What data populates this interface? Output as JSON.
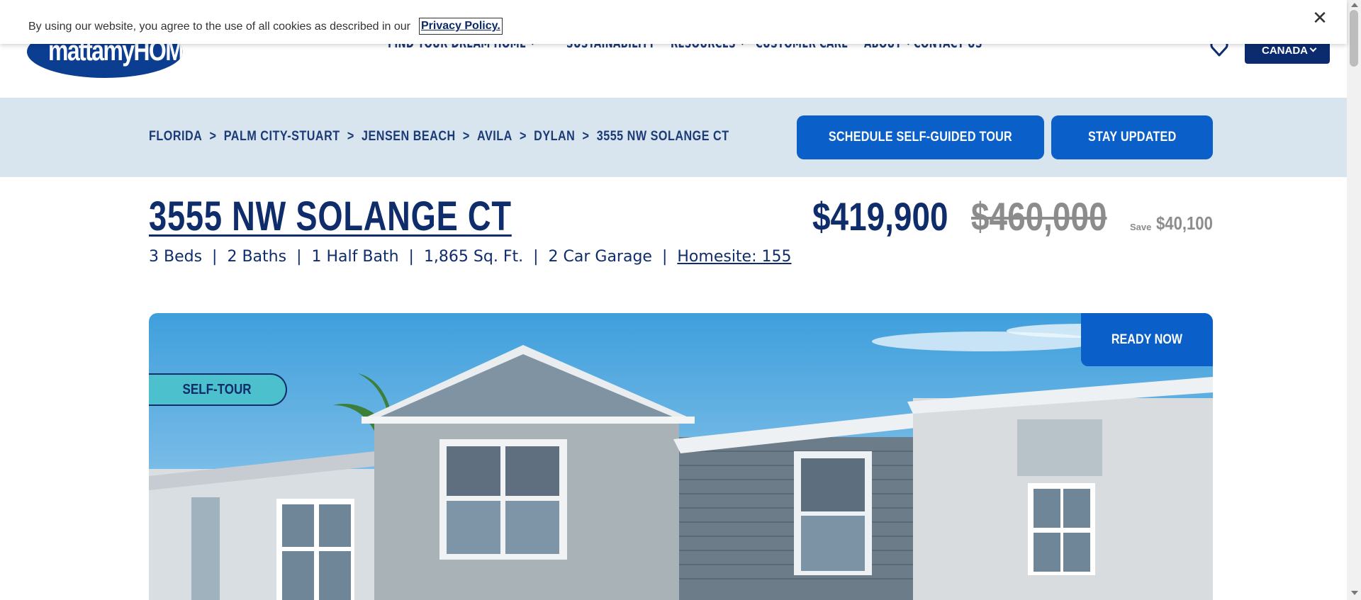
{
  "cookie": {
    "text": "By using our website, you agree to the use of all cookies as described in our",
    "link": "Privacy Policy.",
    "close": "✕"
  },
  "header": {
    "logo": "mattamyHOMES",
    "nav": [
      {
        "label": "FIND YOUR DREAM HOME",
        "has_dropdown": true
      },
      {
        "label": "SUSTAINABILITY",
        "has_dropdown": false
      },
      {
        "label": "RESOURCES",
        "has_dropdown": true
      },
      {
        "label": "CUSTOMER CARE",
        "has_dropdown": false
      },
      {
        "label": "ABOUT",
        "has_dropdown": true
      },
      {
        "label": "CONTACT US",
        "has_dropdown": false
      }
    ],
    "country": "CANADA"
  },
  "breadcrumb": [
    "FLORIDA",
    "PALM CITY-STUART",
    "JENSEN BEACH",
    "AVILA",
    "DYLAN",
    "3555 NW SOLANGE CT"
  ],
  "breadcrumb_sep": ">",
  "actions": {
    "tour": "SCHEDULE SELF-GUIDED TOUR",
    "updated": "STAY UPDATED"
  },
  "listing": {
    "title": "3555 NW SOLANGE CT",
    "price": "$419,900",
    "old_price": "$460,000",
    "save_label": "Save",
    "save_amount": "$40,100",
    "specs": {
      "beds": "3 Beds",
      "baths": "2 Baths",
      "half_bath": "1 Half Bath",
      "sqft": "1,865 Sq. Ft.",
      "garage": "2 Car Garage",
      "homesite": "Homesite: 155"
    },
    "spec_sep": "|",
    "badge_ready": "READY NOW",
    "badge_tour": "SELF-TOUR"
  },
  "colors": {
    "primary_blue": "#0a5fc8",
    "navy": "#0f2c6b",
    "crumb_bg": "#d9e5ee",
    "teal_badge": "#4cc1cd",
    "strike_gray": "#8c8c8c"
  }
}
